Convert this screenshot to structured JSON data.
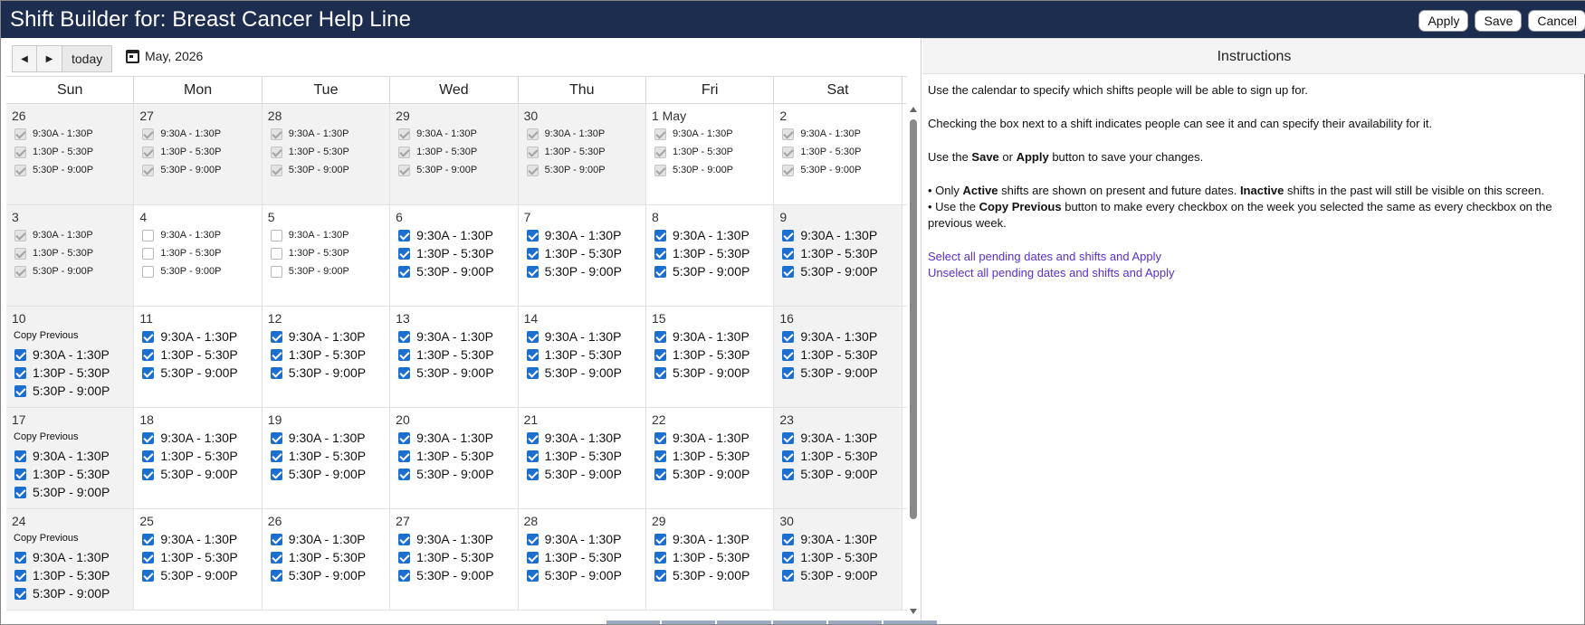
{
  "header": {
    "title": "Shift Builder for: Breast Cancer Help Line",
    "apply_label": "Apply",
    "save_label": "Save",
    "cancel_label": "Cancel"
  },
  "toolbar": {
    "prev_icon": "◀",
    "next_icon": "▶",
    "today_label": "today",
    "month_label": "May, 2026"
  },
  "day_headers": [
    "Sun",
    "Mon",
    "Tue",
    "Wed",
    "Thu",
    "Fri",
    "Sat"
  ],
  "shift_labels": [
    "9:30A - 1:30P",
    "1:30P - 5:30P",
    "5:30P - 9:00P"
  ],
  "copy_previous_label": "Copy Previous",
  "weeks": [
    {
      "days": [
        {
          "label": "26",
          "state": "past",
          "checks": [
            1,
            1,
            1
          ]
        },
        {
          "label": "27",
          "state": "past",
          "checks": [
            1,
            1,
            1
          ]
        },
        {
          "label": "28",
          "state": "past",
          "checks": [
            1,
            1,
            1
          ]
        },
        {
          "label": "29",
          "state": "past",
          "checks": [
            1,
            1,
            1
          ]
        },
        {
          "label": "30",
          "state": "past",
          "checks": [
            1,
            1,
            1
          ]
        },
        {
          "label": "1 May",
          "state": "pastcur",
          "checks": [
            1,
            1,
            1
          ]
        },
        {
          "label": "2",
          "state": "pastcur",
          "checks": [
            1,
            1,
            1
          ]
        }
      ]
    },
    {
      "days": [
        {
          "label": "3",
          "state": "past",
          "checks": [
            1,
            1,
            1
          ]
        },
        {
          "label": "4",
          "state": "pastoff",
          "checks": [
            0,
            0,
            0
          ]
        },
        {
          "label": "5",
          "state": "pastoff",
          "checks": [
            0,
            0,
            0
          ]
        },
        {
          "label": "6",
          "state": "active",
          "checks": [
            1,
            1,
            1
          ]
        },
        {
          "label": "7",
          "state": "active",
          "checks": [
            1,
            1,
            1
          ]
        },
        {
          "label": "8",
          "state": "active",
          "checks": [
            1,
            1,
            1
          ]
        },
        {
          "label": "9",
          "state": "activewknd",
          "checks": [
            1,
            1,
            1
          ]
        }
      ]
    },
    {
      "copy_previous": true,
      "days": [
        {
          "label": "10",
          "state": "activewknd",
          "checks": [
            1,
            1,
            1
          ]
        },
        {
          "label": "11",
          "state": "active",
          "checks": [
            1,
            1,
            1
          ]
        },
        {
          "label": "12",
          "state": "active",
          "checks": [
            1,
            1,
            1
          ]
        },
        {
          "label": "13",
          "state": "active",
          "checks": [
            1,
            1,
            1
          ]
        },
        {
          "label": "14",
          "state": "active",
          "checks": [
            1,
            1,
            1
          ]
        },
        {
          "label": "15",
          "state": "active",
          "checks": [
            1,
            1,
            1
          ]
        },
        {
          "label": "16",
          "state": "activewknd",
          "checks": [
            1,
            1,
            1
          ]
        }
      ]
    },
    {
      "copy_previous": true,
      "days": [
        {
          "label": "17",
          "state": "activewknd",
          "checks": [
            1,
            1,
            1
          ]
        },
        {
          "label": "18",
          "state": "active",
          "checks": [
            1,
            1,
            1
          ]
        },
        {
          "label": "19",
          "state": "active",
          "checks": [
            1,
            1,
            1
          ]
        },
        {
          "label": "20",
          "state": "active",
          "checks": [
            1,
            1,
            1
          ]
        },
        {
          "label": "21",
          "state": "active",
          "checks": [
            1,
            1,
            1
          ]
        },
        {
          "label": "22",
          "state": "active",
          "checks": [
            1,
            1,
            1
          ]
        },
        {
          "label": "23",
          "state": "activewknd",
          "checks": [
            1,
            1,
            1
          ]
        }
      ]
    },
    {
      "copy_previous": true,
      "days": [
        {
          "label": "24",
          "state": "activewknd",
          "checks": [
            1,
            1,
            1
          ]
        },
        {
          "label": "25",
          "state": "active",
          "checks": [
            1,
            1,
            1
          ]
        },
        {
          "label": "26",
          "state": "active",
          "checks": [
            1,
            1,
            1
          ]
        },
        {
          "label": "27",
          "state": "active",
          "checks": [
            1,
            1,
            1
          ]
        },
        {
          "label": "28",
          "state": "active",
          "checks": [
            1,
            1,
            1
          ]
        },
        {
          "label": "29",
          "state": "active",
          "checks": [
            1,
            1,
            1
          ]
        },
        {
          "label": "30",
          "state": "activewknd",
          "checks": [
            1,
            1,
            1
          ]
        }
      ]
    }
  ],
  "instructions": {
    "title": "Instructions",
    "p1": "Use the calendar to specify which shifts people will be able to sign up for.",
    "p2": "Checking the box next to a shift indicates people can see it and can specify their availability for it.",
    "p3_a": "Use the ",
    "p3_save": "Save",
    "p3_b": " or ",
    "p3_apply": "Apply",
    "p3_c": " button to save your changes.",
    "b1_a": "• Only ",
    "b1_active": "Active",
    "b1_b": " shifts are shown on present and future dates. ",
    "b1_inactive": "Inactive",
    "b1_c": " shifts in the past will still be visible on this screen.",
    "b2_a": "• Use the ",
    "b2_copy": "Copy Previous",
    "b2_b": " button to make every checkbox on the week you selected the same as every checkbox on the previous week.",
    "link_select_all": "Select all pending dates and shifts and Apply",
    "link_unselect_all": "Unselect all pending dates and shifts and Apply"
  },
  "colors": {
    "header_bg": "#1c2d4f",
    "checkbox_checked": "#1a6fd1",
    "link": "#5b2fc8"
  }
}
